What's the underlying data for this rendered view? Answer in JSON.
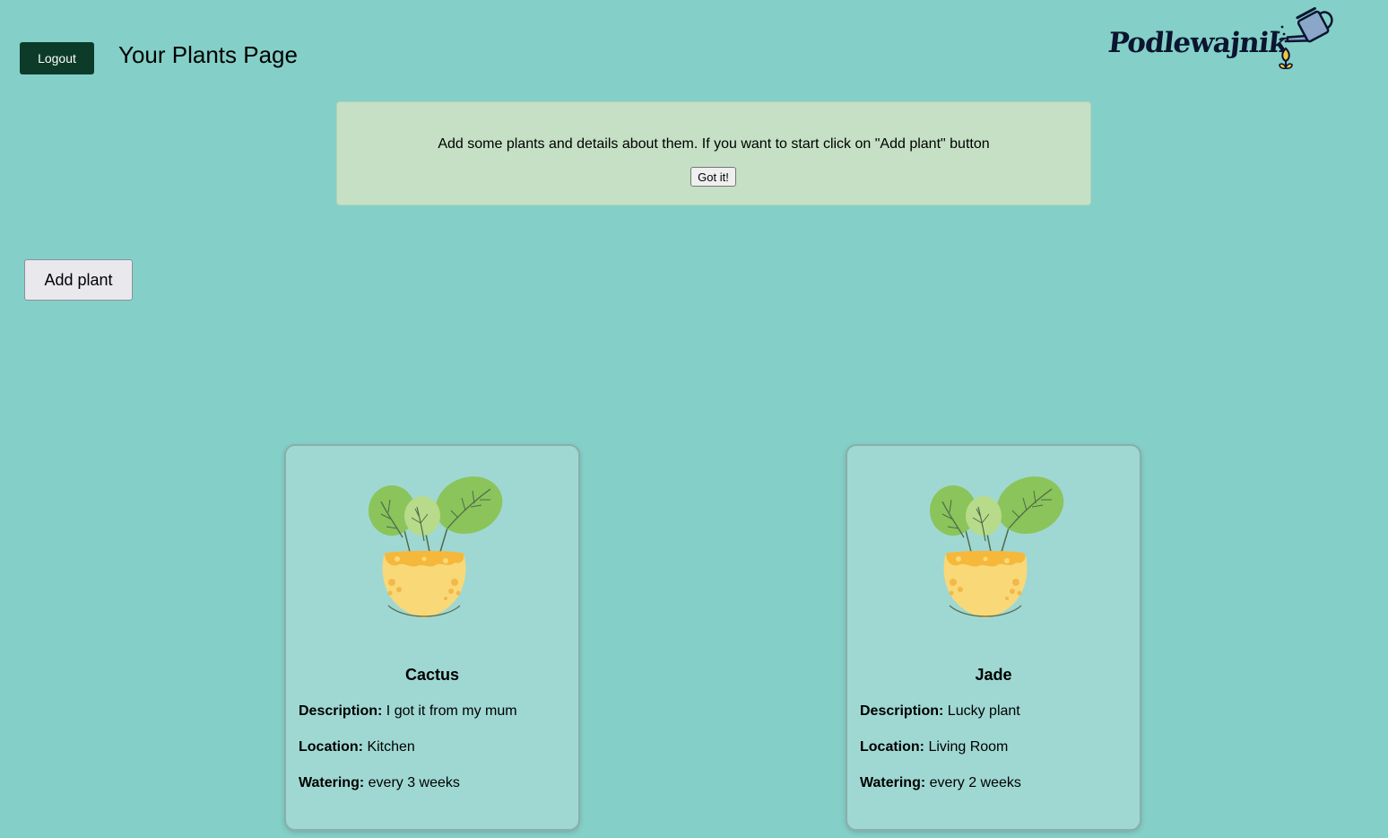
{
  "header": {
    "logout_label": "Logout",
    "page_title": "Your Plants Page",
    "brand_name": "Podlewajnik"
  },
  "info": {
    "message": "Add some plants and details about them. If you want to start click on \"Add plant\" button",
    "dismiss_label": "Got it!"
  },
  "actions": {
    "add_plant_label": "Add plant"
  },
  "field_labels": {
    "description": "Description:",
    "location": "Location:",
    "watering": "Watering:"
  },
  "plants": [
    {
      "name": "Cactus",
      "description": "I got it from my mum",
      "location": "Kitchen",
      "watering": "every 3 weeks",
      "image_icon": "potted-plant-icon"
    },
    {
      "name": "Jade",
      "description": "Lucky plant",
      "location": "Living Room",
      "watering": "every 2 weeks",
      "image_icon": "potted-plant-icon"
    }
  ],
  "colors": {
    "page_background": "#84d0c8",
    "logout_button": "#0c3b2a",
    "info_box": "#c5e0c5",
    "card_background": "#9fd8d2",
    "brand_text": "#0b1530",
    "pot": "#f9d877",
    "leaf": "#8bc45a"
  }
}
